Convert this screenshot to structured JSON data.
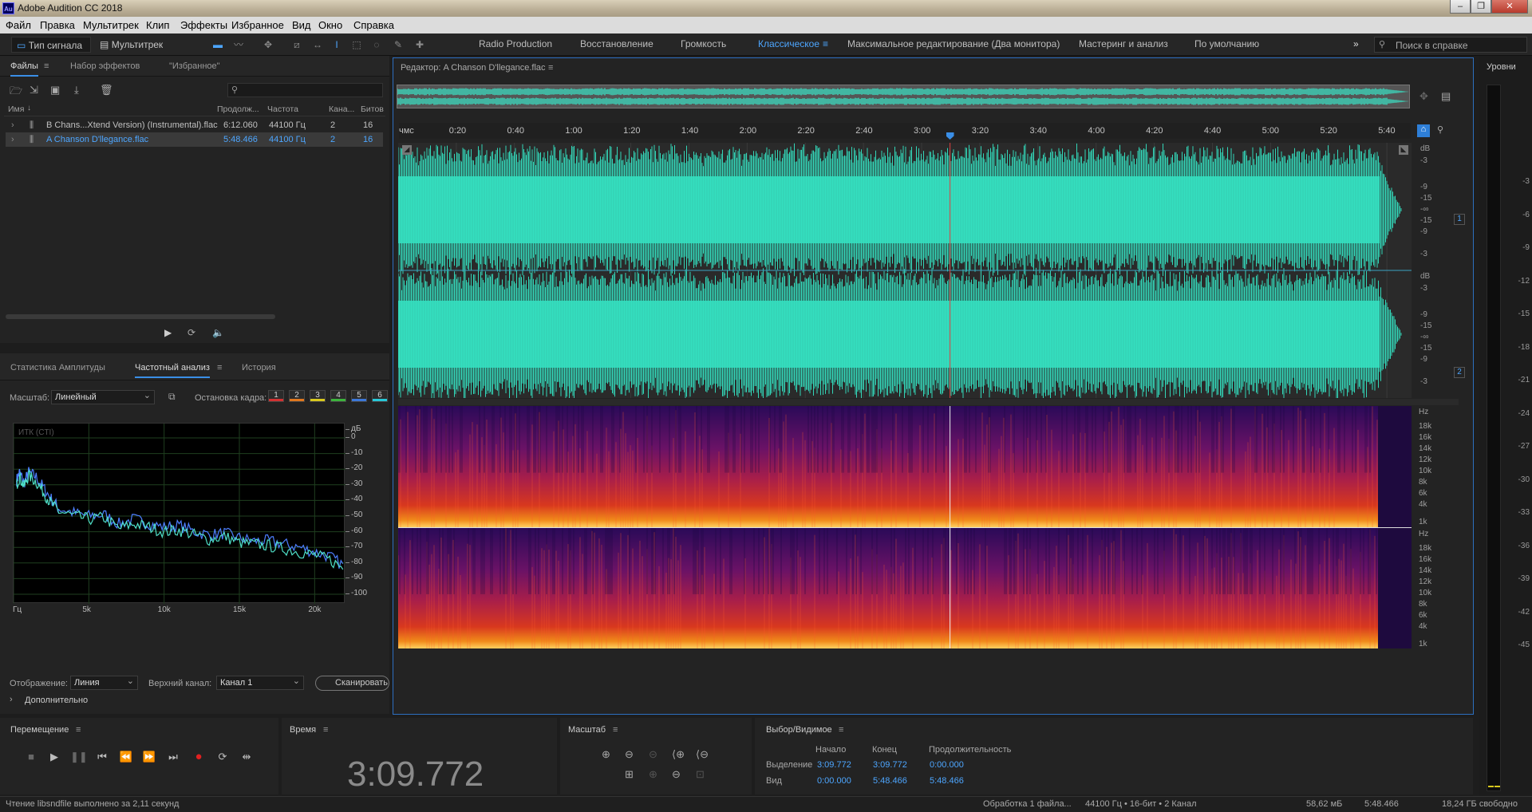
{
  "window": {
    "title": "Adobe Audition CC 2018",
    "app_icon": "Au"
  },
  "menu": [
    "Файл",
    "Правка",
    "Мультитрек",
    "Клип",
    "Эффекты",
    "Избранное",
    "Вид",
    "Окно",
    "Справка"
  ],
  "toolbar": {
    "waveform_label": "Тип сигнала",
    "multitrack_label": "Мультитрек",
    "workspaces": [
      "Radio Production",
      "Восстановление",
      "Громкость",
      "Классическое",
      "Максимальное редактирование (Два монитора)",
      "Мастеринг и анализ",
      "По умолчанию"
    ],
    "active_workspace": "Классическое",
    "more": "»",
    "search_placeholder": "Поиск в справке"
  },
  "files_panel": {
    "tabs": [
      "Файлы",
      "Набор эффектов",
      "\"Избранное\""
    ],
    "columns": [
      "Имя",
      "Продолж...",
      "Частота",
      "Кана...",
      "Битов"
    ],
    "rows": [
      {
        "name": "B Chans...Xtend Version) (Instrumental).flac",
        "duration": "6:12.060",
        "rate": "44100 Гц",
        "channels": "2",
        "bits": "16",
        "selected": false
      },
      {
        "name": "A Chanson D'llegance.flac",
        "duration": "5:48.466",
        "rate": "44100 Гц",
        "channels": "2",
        "bits": "16",
        "selected": true
      }
    ]
  },
  "analysis_panel": {
    "tabs": [
      "Статистика Амплитуды",
      "Частотный анализ",
      "История"
    ],
    "scale_label": "Масштаб:",
    "scale_value": "Линейный",
    "freeze_label": "Остановка кадра:",
    "freeze_slots": [
      "1",
      "2",
      "3",
      "4",
      "5",
      "6"
    ],
    "freeze_colors": [
      "#d23232",
      "#e0781e",
      "#d8c81e",
      "#3cb43c",
      "#3c78d8",
      "#28c8d8"
    ],
    "display_label": "Отображение:",
    "display_value": "Линия",
    "channel_label": "Верхний канал:",
    "channel_value": "Канал 1",
    "scan_button": "Сканировать",
    "advanced": "Дополнительно",
    "chart_inner_label": "ИТК (CTI)"
  },
  "chart_data": {
    "type": "line",
    "x_ticks": [
      "Гц",
      "5k",
      "10k",
      "15k",
      "20k"
    ],
    "y_ticks": [
      "дБ",
      "0",
      "-10",
      "-20",
      "-30",
      "-40",
      "-50",
      "-60",
      "-70",
      "-80",
      "-90",
      "-100"
    ],
    "xlim": [
      0,
      22050
    ],
    "ylim": [
      -100,
      0
    ],
    "grid": true,
    "series": [
      {
        "color": "#4d7fff",
        "x": [
          200,
          400,
          700,
          1000,
          1500,
          2000,
          2500,
          3000,
          4000,
          5000,
          6000,
          7000,
          8000,
          9000,
          10000,
          11000,
          12000,
          13000,
          14000,
          15000,
          16000,
          17000,
          18000,
          19000,
          20000,
          21000,
          22000
        ],
        "y": [
          -27,
          -22,
          -29,
          -22,
          -25,
          -32,
          -39,
          -45,
          -48,
          -50,
          -49,
          -55,
          -52,
          -55,
          -57,
          -56,
          -60,
          -62,
          -61,
          -64,
          -66,
          -66,
          -68,
          -70,
          -73,
          -76,
          -82
        ]
      },
      {
        "color": "#4fe0c8",
        "x": [
          200,
          400,
          700,
          1000,
          1500,
          2000,
          2500,
          3000,
          4000,
          5000,
          6000,
          7000,
          8000,
          9000,
          10000,
          11000,
          12000,
          13000,
          14000,
          15000,
          16000,
          17000,
          18000,
          19000,
          20000,
          21000,
          22000
        ],
        "y": [
          -30,
          -25,
          -31,
          -24,
          -28,
          -35,
          -42,
          -47,
          -50,
          -52,
          -51,
          -58,
          -55,
          -57,
          -60,
          -59,
          -62,
          -65,
          -63,
          -67,
          -68,
          -69,
          -71,
          -73,
          -75,
          -78,
          -84
        ]
      }
    ]
  },
  "editor": {
    "title": "Редактор: A Chanson D'llegance.flac",
    "ruler_unit": "чмс",
    "ruler_labels": [
      "0:20",
      "0:40",
      "1:00",
      "1:20",
      "1:40",
      "2:00",
      "2:20",
      "2:40",
      "3:00",
      "3:20",
      "3:40",
      "4:00",
      "4:20",
      "4:40",
      "5:00",
      "5:20",
      "5:40"
    ],
    "db_top": [
      "dB",
      "-3",
      "-9",
      "-15",
      "-∞",
      "-15",
      "-9",
      "-3"
    ],
    "db_bottom": [
      "dB",
      "-3",
      "-9",
      "-15",
      "-∞",
      "-15",
      "-9",
      "-3"
    ],
    "hz_labels": [
      "Hz",
      "18k",
      "16k",
      "14k",
      "12k",
      "10k",
      "8k",
      "6k",
      "4k",
      "1k"
    ],
    "channels": [
      "1",
      "2"
    ],
    "wave_color": "#34e0c0",
    "playhead_color": "#e04040",
    "duration_s": 348.466,
    "playhead_s": 189.772
  },
  "meter": {
    "title": "Уровни",
    "scale": [
      "-3",
      "-6",
      "-9",
      "-12",
      "-15",
      "-18",
      "-21",
      "-24",
      "-27",
      "-30",
      "-33",
      "-36",
      "-39",
      "-42",
      "-45"
    ]
  },
  "transport": {
    "title": "Перемещение",
    "buttons": [
      "stop-icon",
      "play-icon",
      "pause-icon",
      "go-start-icon",
      "rewind-icon",
      "forward-icon",
      "go-end-icon",
      "record-icon",
      "loop-icon",
      "skip-icon"
    ]
  },
  "time_panel": {
    "title": "Время",
    "value": "3:09.772"
  },
  "zoom_panel": {
    "title": "Масштаб"
  },
  "selection_panel": {
    "title": "Выбор/Видимое",
    "headers": [
      "Начало",
      "Конец",
      "Продолжительность"
    ],
    "rows": [
      {
        "label": "Выделение",
        "start": "3:09.772",
        "end": "3:09.772",
        "duration": "0:00.000"
      },
      {
        "label": "Вид",
        "start": "0:00.000",
        "end": "5:48.466",
        "duration": "5:48.466"
      }
    ]
  },
  "status": {
    "left": "Чтение libsndfile выполнено за 2,11 секунд",
    "processing": "Обработка 1 файла...",
    "format": "44100 Гц • 16-бит • 2 Канал",
    "size": "58,62 мБ",
    "duration": "5:48.466",
    "free": "18,24 ГБ свободно"
  }
}
